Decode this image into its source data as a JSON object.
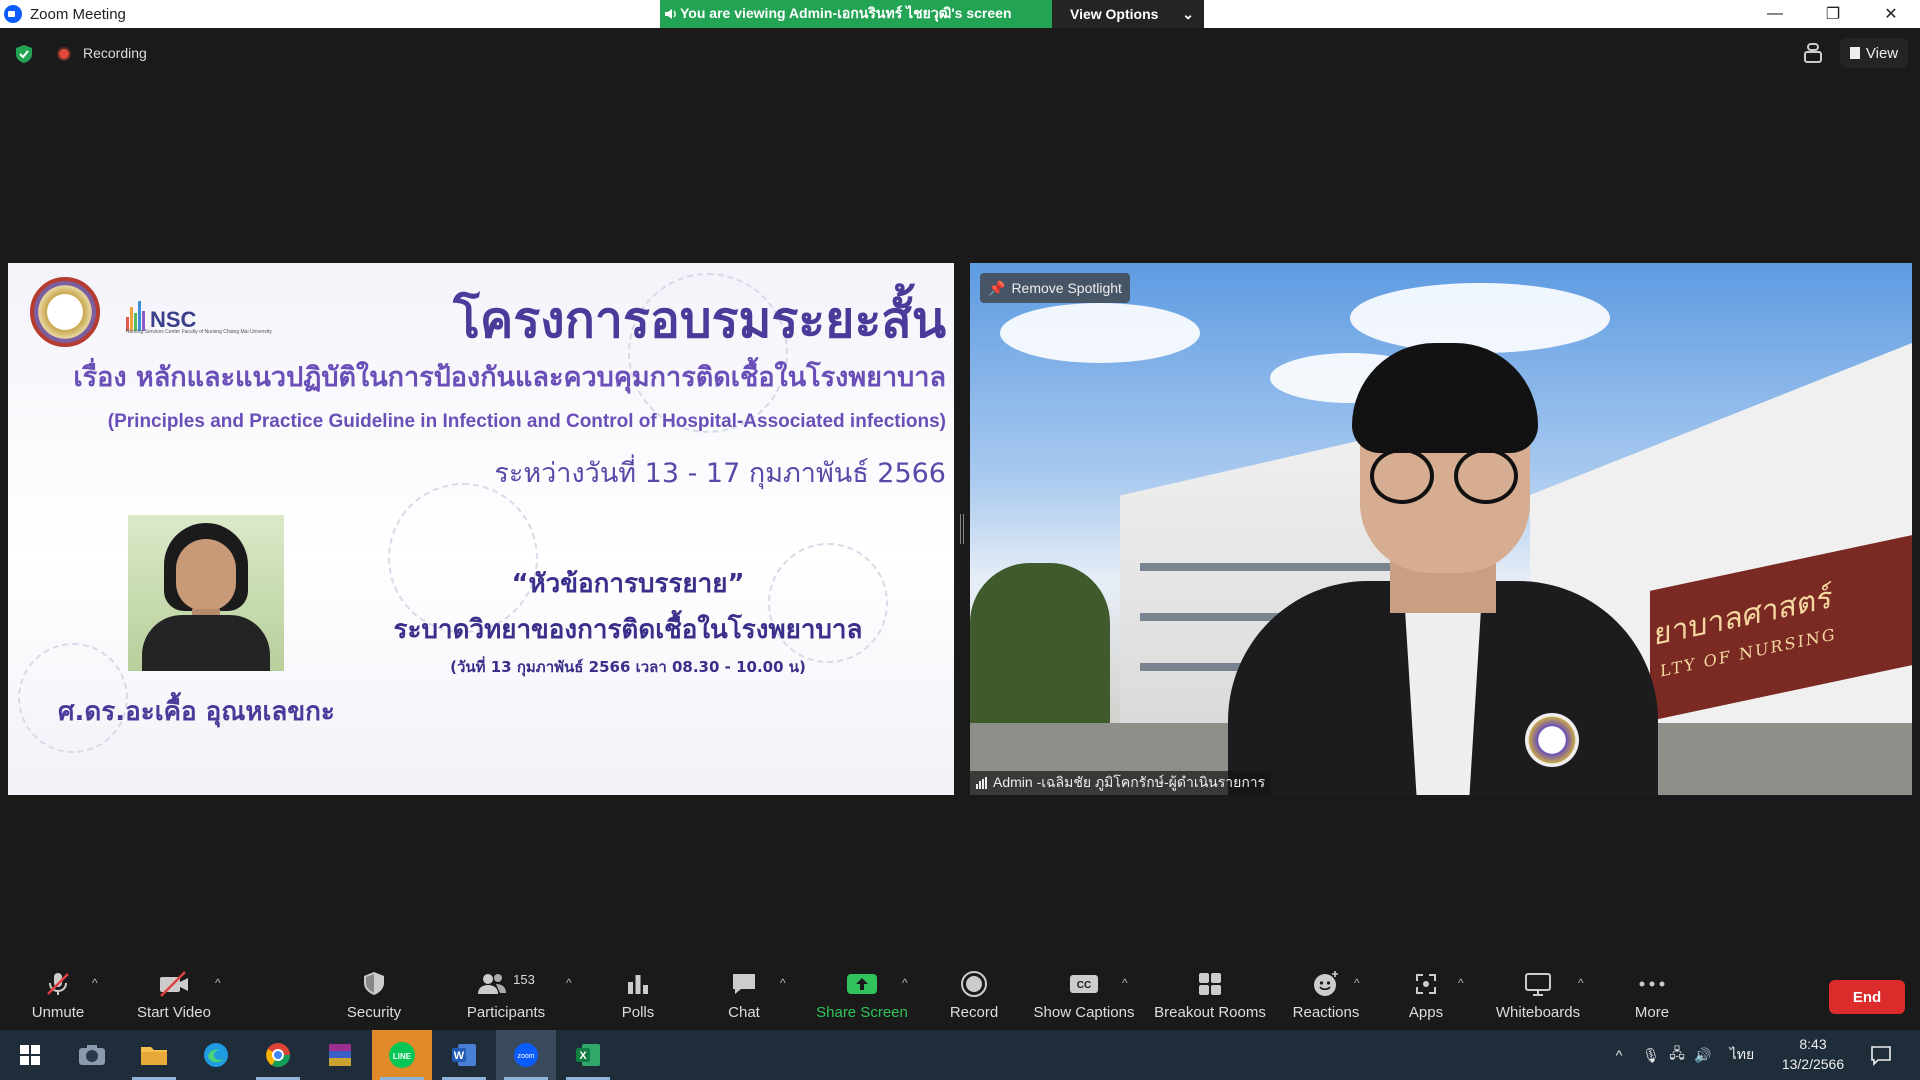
{
  "window": {
    "title": "Zoom Meeting",
    "banner_text": "You are viewing Admin-เอกนรินทร์ ไชยวุฒิ's screen",
    "view_options_label": "View Options"
  },
  "infobar": {
    "recording_label": "Recording",
    "view_label": "View"
  },
  "slide": {
    "org_name": "NSC",
    "org_sub": "Nursing Services Center Faculty of Nursing Chiang Mai University",
    "title": "โครงการอบรมระยะสั้น",
    "subtitle_th": "เรื่อง หลักและแนวปฏิบัติในการป้องกันและควบคุมการติดเชื้อในโรงพยาบาล",
    "subtitle_en": "(Principles and Practice Guideline in Infection and Control of Hospital-Associated infections)",
    "dates": "ระหว่างวันที่ 13 - 17 กุมภาพันธ์ 2566",
    "topic_header": "“หัวข้อการบรรยาย”",
    "topic_title": "ระบาดวิทยาของการติดเชื้อในโรงพยาบาล",
    "topic_time": "(วันที่ 13 กุมภาพันธ์ 2566 เวลา 08.30 - 10.00 น)",
    "speaker_name": "ศ.ดร.อะเคื้อ อุณหเลขกะ"
  },
  "video": {
    "remove_spotlight_label": "Remove Spotlight",
    "participant_name": "Admin -เฉลิมชัย ภูมิโคกรักษ์-ผู้ดำเนินรายการ",
    "sign_text_th": "ยาบาลศาสตร์",
    "sign_text_en": "LTY OF NURSING"
  },
  "toolbar": {
    "unmute": "Unmute",
    "start_video": "Start Video",
    "security": "Security",
    "participants": "Participants",
    "participant_count": "153",
    "polls": "Polls",
    "chat": "Chat",
    "share_screen": "Share Screen",
    "record": "Record",
    "show_captions": "Show Captions",
    "breakout_rooms": "Breakout Rooms",
    "reactions": "Reactions",
    "apps": "Apps",
    "whiteboards": "Whiteboards",
    "more": "More",
    "end": "End"
  },
  "taskbar": {
    "apps": [
      "windows-start-icon",
      "camera-app-icon",
      "file-explorer-icon",
      "edge-browser-icon",
      "chrome-browser-icon",
      "winrar-icon",
      "line-app-icon",
      "word-app-icon",
      "zoom-app-icon",
      "excel-app-icon"
    ],
    "language": "ไทย",
    "time": "8:43",
    "date": "13/2/2566"
  },
  "colors": {
    "banner_green": "#23a455",
    "end_red": "#dc2b2b",
    "share_green": "#30c35b",
    "slide_purple": "#4a3a99"
  }
}
